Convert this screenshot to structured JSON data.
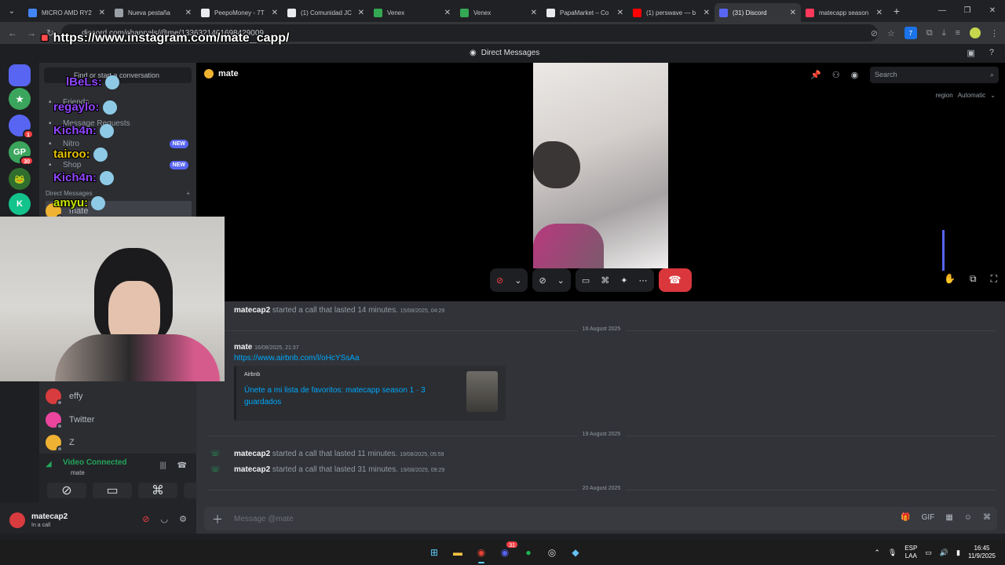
{
  "browser": {
    "tabs": [
      {
        "label": "MICRO AMD RY2",
        "color": "#4285f4"
      },
      {
        "label": "Nueva pestaña",
        "color": "#9aa0a6"
      },
      {
        "label": "PeepoMoney - 7T",
        "color": "#e8eaed"
      },
      {
        "label": "(1) Comunidad JC",
        "color": "#e8eaed"
      },
      {
        "label": "Venex",
        "color": "#34a853"
      },
      {
        "label": "Venex",
        "color": "#34a853"
      },
      {
        "label": "PapaMarket – Co",
        "color": "#e8eaed"
      },
      {
        "label": "(1) perswave — b",
        "color": "#ff0000"
      },
      {
        "label": "(31) Discord",
        "color": "#5865f2"
      },
      {
        "label": "matecapp season",
        "color": "#ff385c"
      }
    ],
    "active_tab_index": 8,
    "url": "discord.com/channels/@me/1336321461698429009"
  },
  "discord": {
    "title": "Direct Messages",
    "guilds": [
      {
        "letter": "",
        "color": "#5865f2",
        "badge": ""
      },
      {
        "letter": "★",
        "color": "#3ba55d",
        "badge": ""
      },
      {
        "letter": "",
        "color": "#5865f2",
        "badge": "1"
      },
      {
        "letter": "GP",
        "color": "#3ba55d",
        "badge": "30"
      },
      {
        "letter": "🐸",
        "color": "#2f6e2f",
        "badge": ""
      },
      {
        "letter": "K",
        "color": "#12c48b",
        "badge": ""
      }
    ],
    "sidebar": {
      "find_placeholder": "Find or start a conversation",
      "nav": [
        {
          "label": "Friends",
          "badge": ""
        },
        {
          "label": "Message Requests",
          "badge": ""
        },
        {
          "label": "Nitro",
          "badge": "NEW"
        },
        {
          "label": "Shop",
          "badge": "NEW"
        }
      ],
      "dm_header": "Direct Messages",
      "dm_add": "+",
      "dms": [
        {
          "name": "mate",
          "color": "#f0b232"
        },
        {
          "name": "effy",
          "color": "#d83c3e"
        },
        {
          "name": "Twitter",
          "color": "#eb459e"
        },
        {
          "name": "Z",
          "color": "#f0b232"
        }
      ]
    },
    "voice": {
      "status": "Video Connected",
      "channel": "mate"
    },
    "user": {
      "name": "matecap2",
      "status": "In a call"
    },
    "call": {
      "header_name": "mate",
      "search_placeholder": "Search",
      "region_label": "region",
      "region_value": "Automatic"
    },
    "messages": [
      {
        "author": "matecap2",
        "text": "started a call that lasted 14 minutes.",
        "time": "15/08/2025, 04:29"
      },
      {
        "divider": "16 August 2025"
      },
      {
        "author": "mate",
        "time": "16/08/2025, 21:37",
        "link": "https://www.airbnb.com/l/oHcYSsAa",
        "embed": {
          "provider": "Airbnb",
          "title": "Únete a mi lista de favoritos: matecapp season 1 · 3 guardados"
        }
      },
      {
        "divider": "19 August 2025"
      },
      {
        "author": "matecap2",
        "text": "started a call that lasted 11 minutes.",
        "time": "19/08/2025, 05:59"
      },
      {
        "author": "matecap2",
        "text": "started a call that lasted 31 minutes.",
        "time": "19/08/2025, 09:29"
      },
      {
        "divider": "20 August 2025"
      }
    ],
    "composer_placeholder": "Message @mate"
  },
  "stream_overlay": {
    "top_link": "https://www.instagram.com/mate_capp/",
    "chat": [
      {
        "user": "lBeLs:",
        "color": "#9146ff"
      },
      {
        "user": "regaylo:",
        "color": "#9146ff"
      },
      {
        "user": "Kich4n:",
        "color": "#9146ff"
      },
      {
        "user": "tairoo:",
        "color": "#e6c200"
      },
      {
        "user": "Kich4n:",
        "color": "#9146ff"
      },
      {
        "user": "amyu:",
        "color": "#c8e600"
      }
    ]
  },
  "taskbar": {
    "lang_top": "ESP",
    "lang_bottom": "LAA",
    "time": "16:45",
    "date": "11/9/2025",
    "discord_badge": "31"
  }
}
